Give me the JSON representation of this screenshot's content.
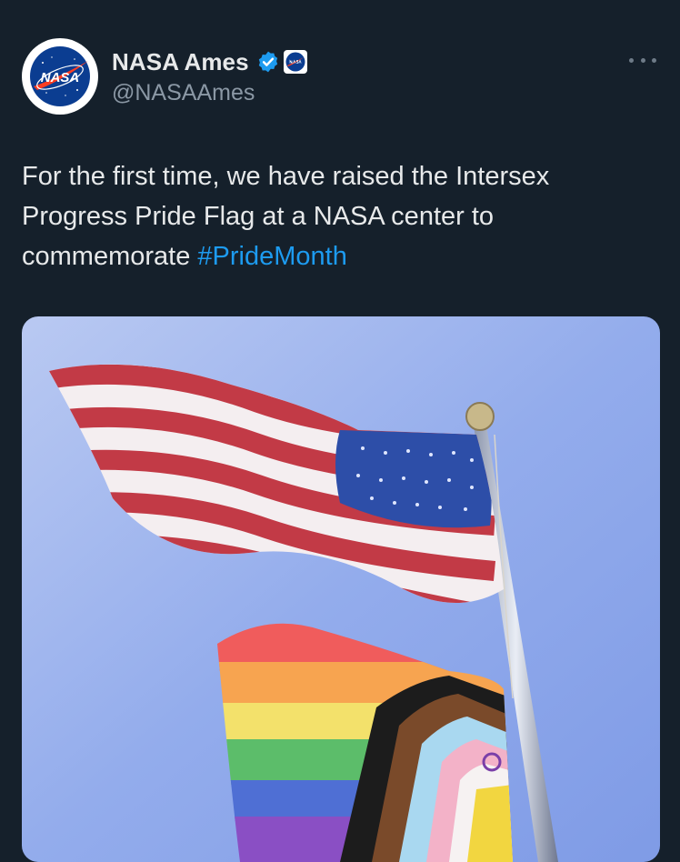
{
  "author": {
    "display_name": "NASA Ames",
    "handle": "@NASAAmes",
    "avatar_logo_text": "NASA",
    "verified_icon": "verified-badge-icon",
    "affiliate_icon": "nasa-affiliate-badge-icon"
  },
  "tweet": {
    "text_before": "For the first time, we have raised the Intersex Progress Pride Flag at a NASA center to commemorate ",
    "hashtag": "#PrideMonth"
  },
  "colors": {
    "background": "#15202b",
    "primary_text": "#e7e9ea",
    "secondary_text": "#8b98a5",
    "link": "#1d9bf0",
    "verified": "#1d9bf0"
  },
  "icons": {
    "more": "more-horizontal-icon"
  }
}
